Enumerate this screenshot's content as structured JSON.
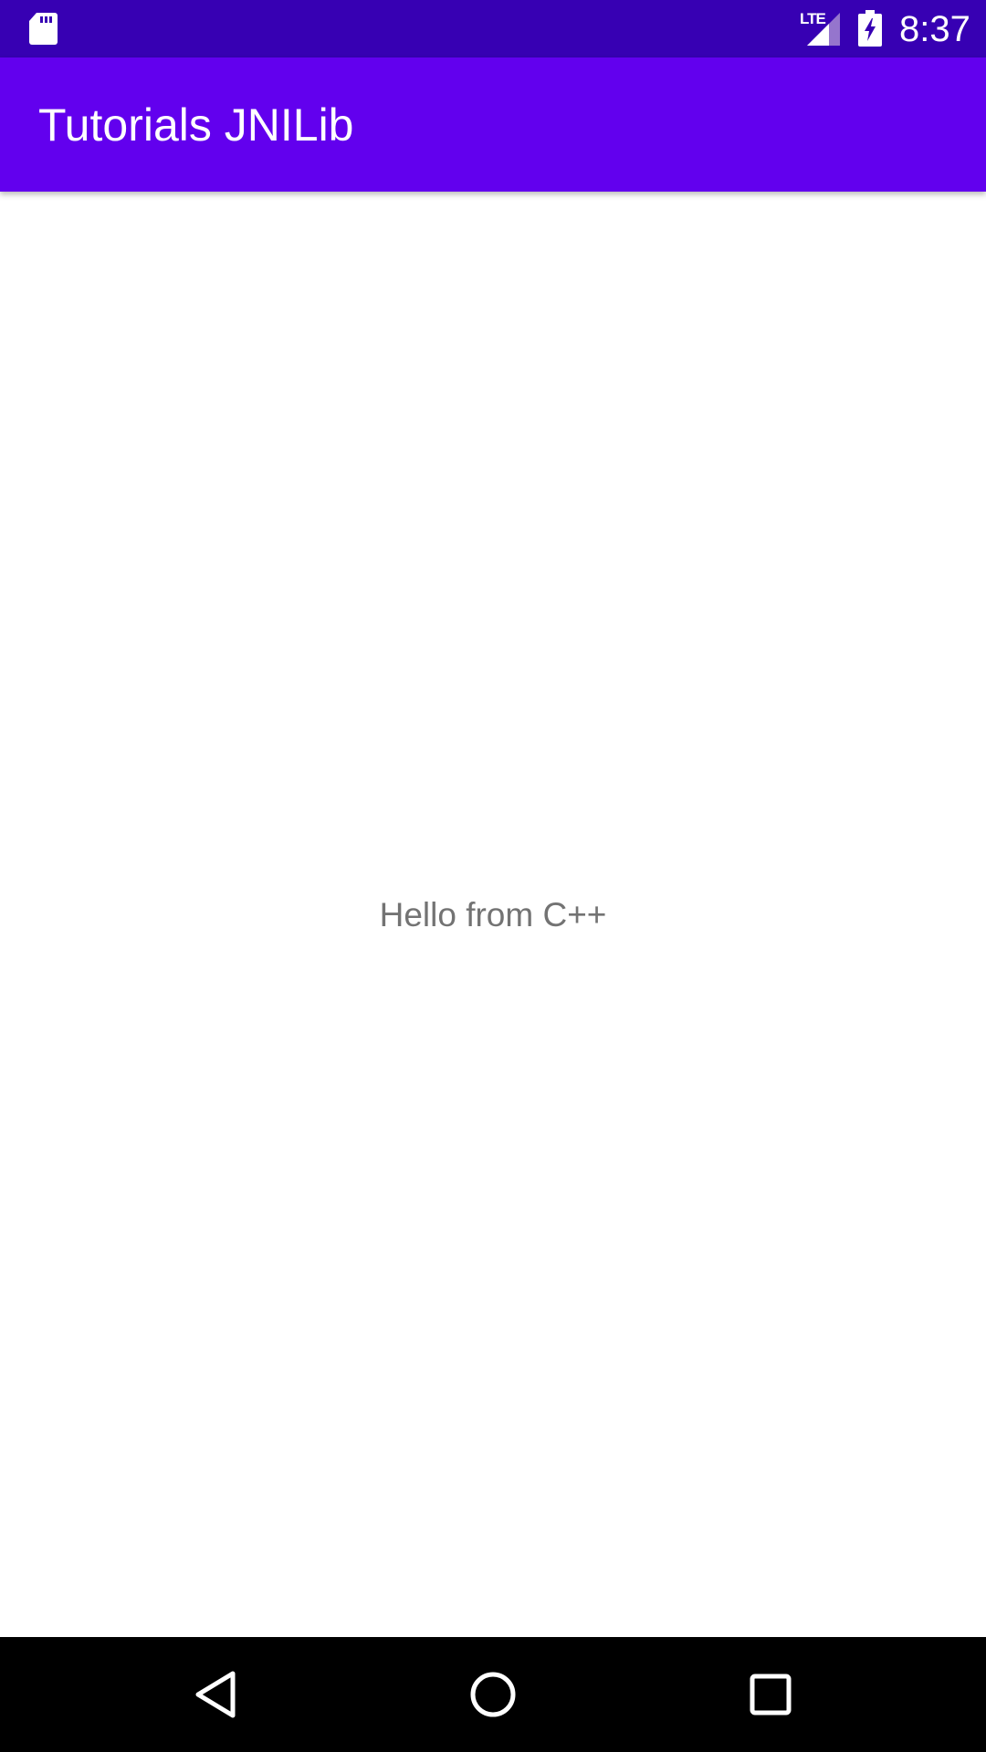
{
  "status_bar": {
    "storage_icon": "sd-card-icon",
    "network_label": "LTE",
    "signal_icon": "cell-signal-icon",
    "battery_icon": "battery-charging-icon",
    "time": "8:37",
    "background_color": "#3700b3"
  },
  "app_bar": {
    "title": "Tutorials JNILib",
    "background_color": "#6200ee"
  },
  "content": {
    "message": "Hello from C++",
    "text_color": "#737373"
  },
  "nav_bar": {
    "back_icon": "back-triangle-icon",
    "home_icon": "home-circle-icon",
    "recents_icon": "recents-square-icon",
    "background_color": "#000000"
  }
}
